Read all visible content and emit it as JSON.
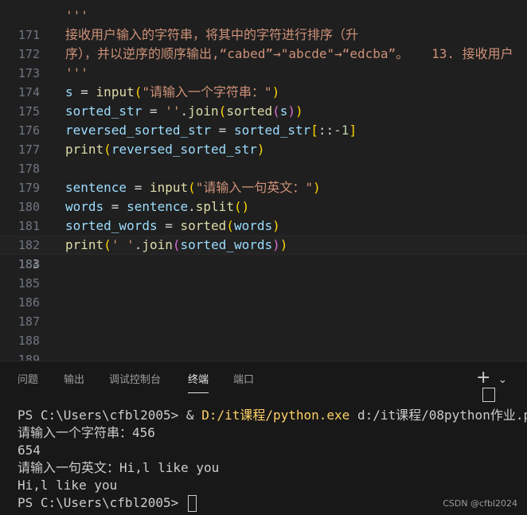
{
  "editor": {
    "lines": [
      {
        "n": "171",
        "text": "'''"
      },
      {
        "n": "172",
        "text": "接收用户输入的字符串，将其中的字符进行排序（升"
      },
      {
        "n": "173",
        "text": "序），并以逆序的顺序输出,“cabed”→\"abcde\"→“edcba”。   13. 接收用户"
      },
      {
        "n": "174",
        "text": "'''"
      },
      {
        "n": "175",
        "a": "s",
        "b": " = ",
        "c": "input",
        "d": "(",
        "e": "\"请输入一个字符串：\"",
        "f": ")"
      },
      {
        "n": "176",
        "a": "sorted_str",
        "b": " = ",
        "c": "''",
        "d": ".",
        "e": "join",
        "f": "(",
        "g": "sorted",
        "h": "(",
        "i": "s",
        "j": "))"
      },
      {
        "n": "177",
        "a": "reversed_sorted_str",
        "b": " = ",
        "c": "sorted_str",
        "d": "[",
        "e": "::",
        "f": "-1",
        "g": "]"
      },
      {
        "n": "178",
        "a": "print",
        "b": "(",
        "c": "reversed_sorted_str",
        "d": ")"
      },
      {
        "n": "179"
      },
      {
        "n": "180",
        "a": "sentence",
        "b": " = ",
        "c": "input",
        "d": "(",
        "e": "\"请输入一句英文：\"",
        "f": ")"
      },
      {
        "n": "181",
        "a": "words",
        "b": " = ",
        "c": "sentence",
        "d": ".",
        "e": "split",
        "f": "()"
      },
      {
        "n": "182",
        "a": "sorted_words",
        "b": " = ",
        "c": "sorted",
        "d": "(",
        "e": "words",
        "f": ")"
      },
      {
        "n": "183",
        "a": "print",
        "b": "(",
        "c": "' '",
        "d": ".",
        "e": "join",
        "f": "(",
        "g": "sorted_words",
        "h": ")",
        "i": ")"
      },
      {
        "n": "184"
      },
      {
        "n": "185"
      },
      {
        "n": "186"
      },
      {
        "n": "187"
      },
      {
        "n": "188"
      },
      {
        "n": "189"
      }
    ]
  },
  "panel": {
    "tabs": [
      "问题",
      "输出",
      "调试控制台",
      "终端",
      "端口"
    ],
    "active_tab": "终端",
    "terminal": {
      "l1_prompt": "PS C:\\Users\\cfbl2005> ",
      "l1_amp": "& ",
      "l1_exe": "D:/it课程/python.exe",
      "l1_arg": " d:/it课程/08python作业.py",
      "l2": "请输入一个字符串：456",
      "l3": "654",
      "l4": "请输入一句英文：Hi,l like you",
      "l5": "Hi,l like you",
      "l6_prompt": "PS C:\\Users\\cfbl2005> "
    },
    "watermark": "CSDN @cfbl2024"
  },
  "icons": {
    "plus": "+",
    "chevron": "⌄"
  }
}
